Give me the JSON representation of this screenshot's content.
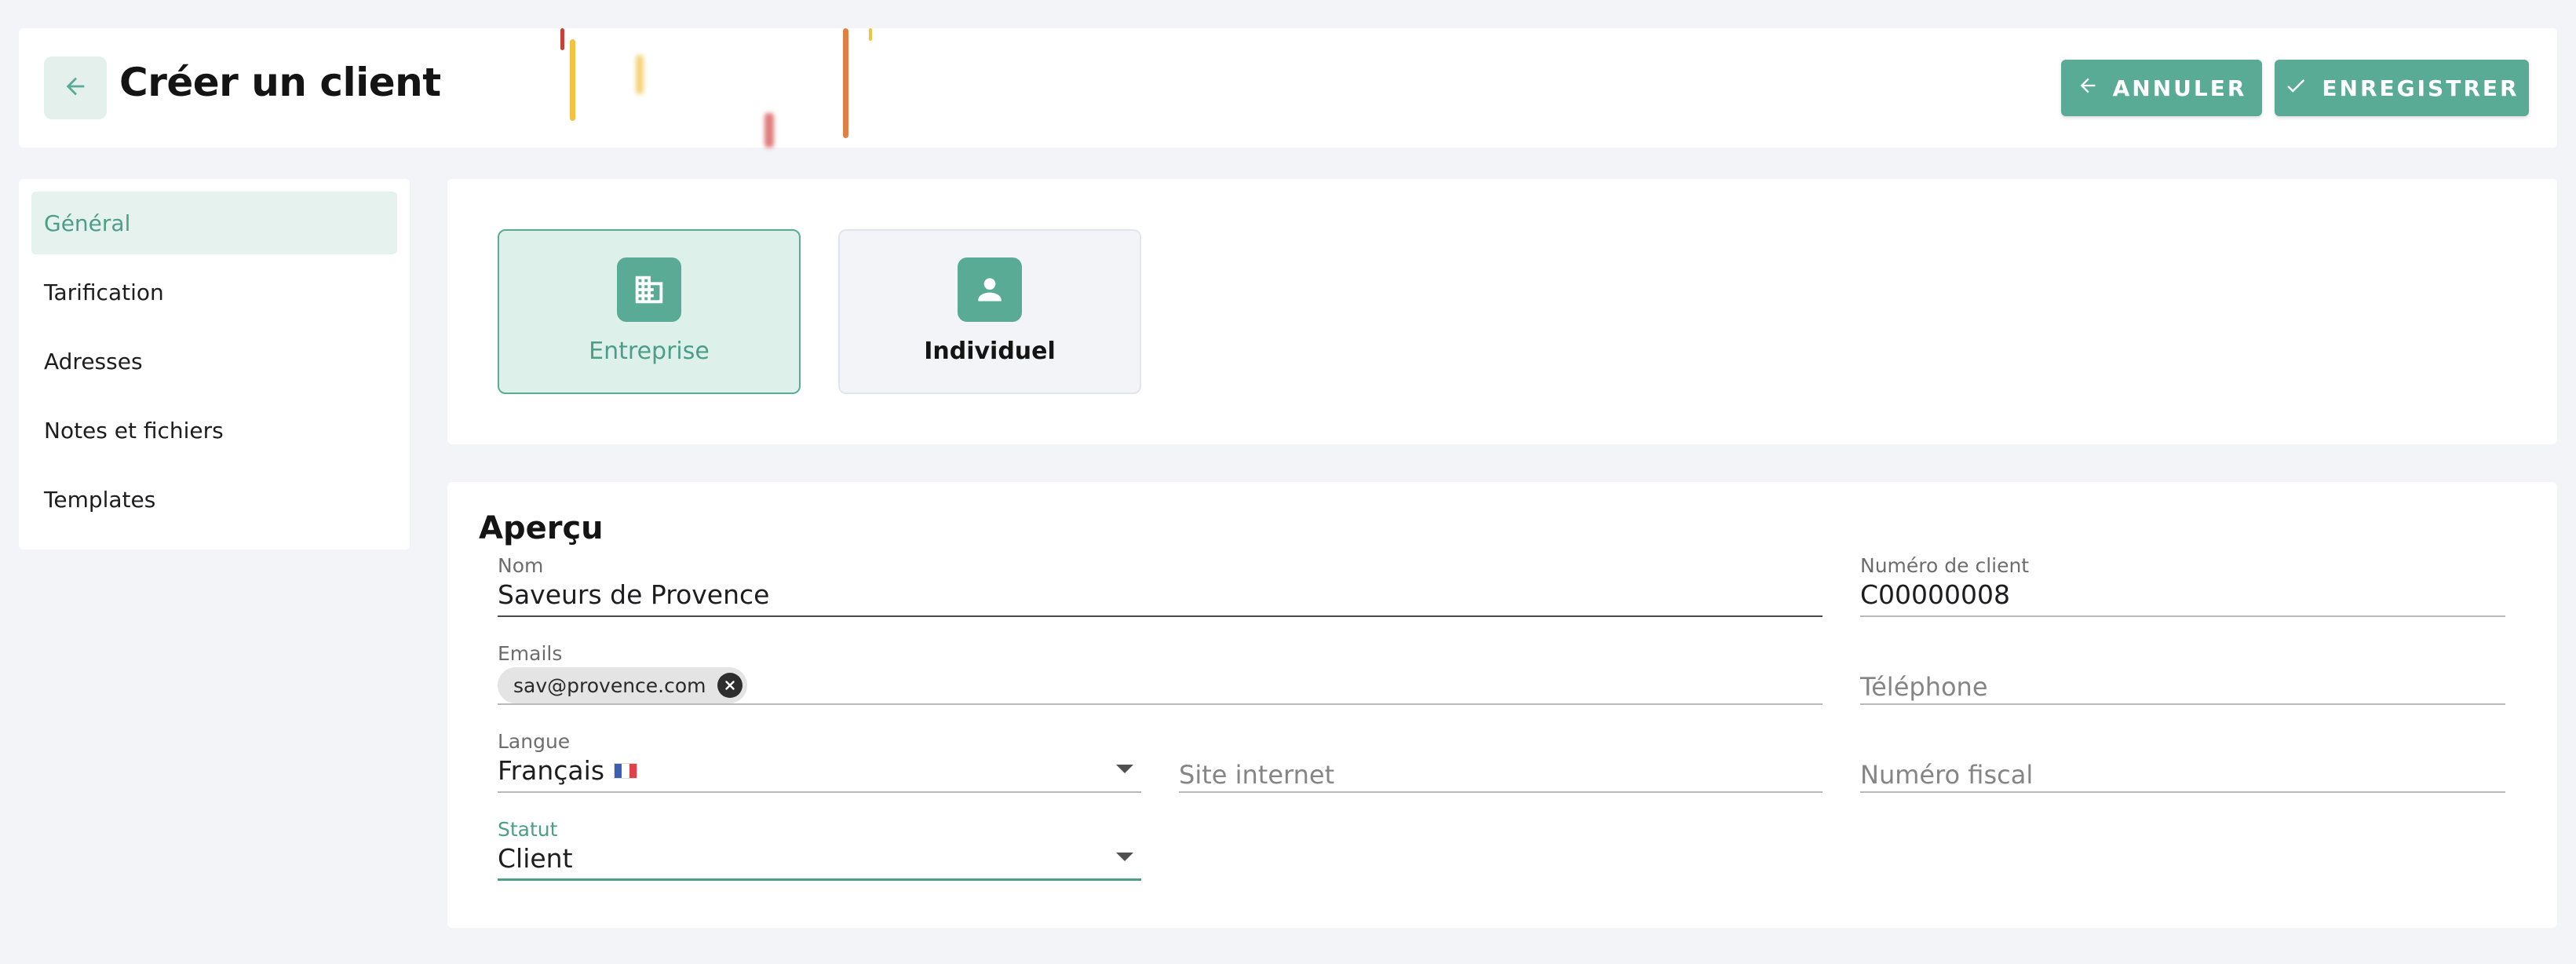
{
  "header": {
    "title": "Créer un client",
    "cancel_label": "ANNULER",
    "save_label": "ENREGISTRER",
    "icons": {
      "back": "arrow-left-icon",
      "cancel": "arrow-left-icon",
      "save": "check-icon"
    }
  },
  "sidebar": {
    "items": [
      {
        "label": "Général",
        "active": true
      },
      {
        "label": "Tarification",
        "active": false
      },
      {
        "label": "Adresses",
        "active": false
      },
      {
        "label": "Notes et fichiers",
        "active": false
      },
      {
        "label": "Templates",
        "active": false
      }
    ]
  },
  "client_type": {
    "options": [
      {
        "label": "Entreprise",
        "icon": "building-icon",
        "selected": true
      },
      {
        "label": "Individuel",
        "icon": "person-icon",
        "selected": false
      }
    ]
  },
  "overview": {
    "title": "Aperçu",
    "nom": {
      "label": "Nom",
      "value": "Saveurs de Provence"
    },
    "numero_client": {
      "label": "Numéro de client",
      "value": "C00000008"
    },
    "emails": {
      "label": "Emails",
      "chips": [
        "sav@provence.com"
      ]
    },
    "telephone": {
      "placeholder": "Téléphone"
    },
    "langue": {
      "label": "Langue",
      "value": "Français",
      "flag": "fr-flag-icon"
    },
    "site_internet": {
      "placeholder": "Site internet"
    },
    "numero_fiscal": {
      "placeholder": "Numéro fiscal"
    },
    "statut": {
      "label": "Statut",
      "value": "Client"
    }
  },
  "colors": {
    "accent": "#5aab95",
    "accent_text": "#4c9e86",
    "accent_light": "#def0ea",
    "background": "#f3f4f8"
  }
}
